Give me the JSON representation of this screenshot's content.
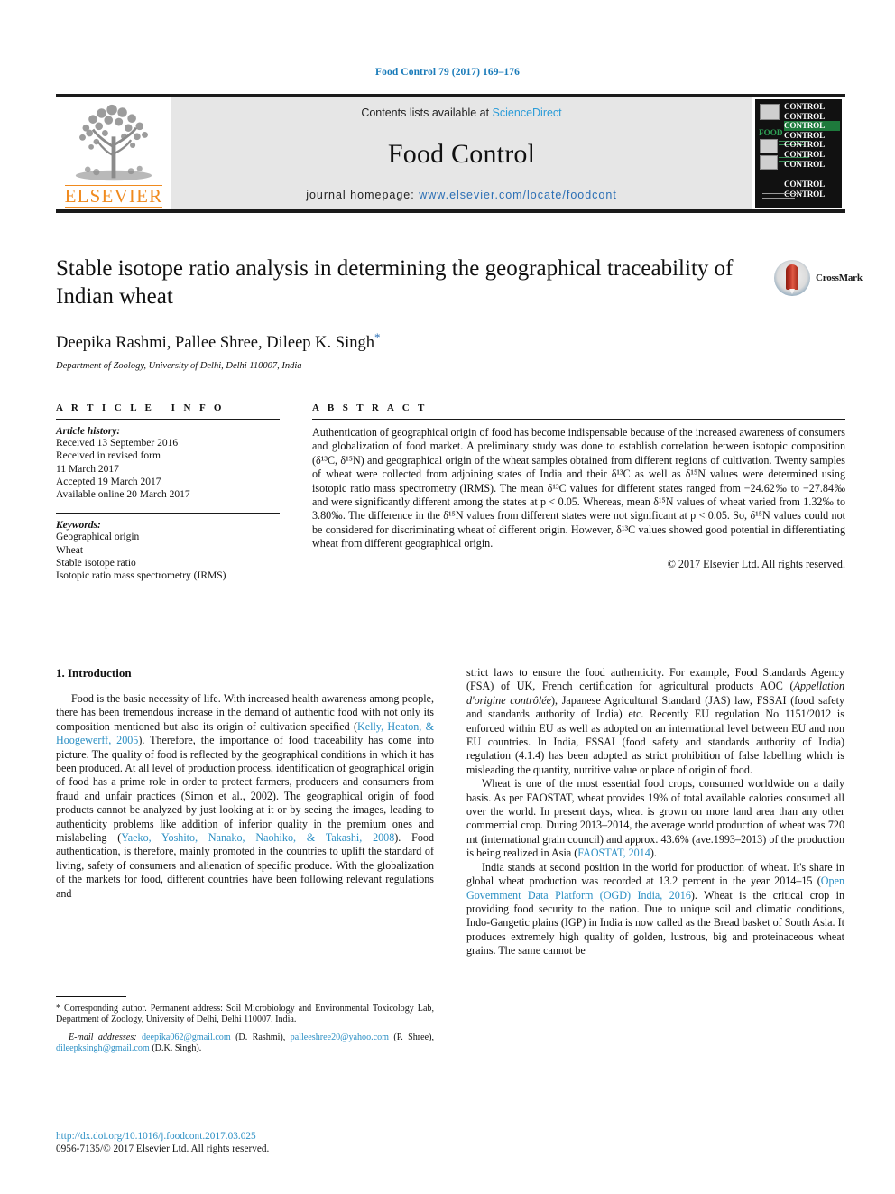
{
  "running_head": "Food Control 79 (2017) 169–176",
  "masthead": {
    "contents_prefix": "Contents lists available at ",
    "sciencedirect": "ScienceDirect",
    "journal_title": "Food Control",
    "homepage_prefix": "journal homepage: ",
    "homepage_url": "www.elsevier.com/locate/foodcont",
    "publisher_wordmark": "ELSEVIER",
    "cover": {
      "food_word": "FOOD",
      "control_word": "CONTROL",
      "control_repeat": 9
    },
    "colors": {
      "link_blue": "#2b9cd8",
      "homepage_blue": "#2b6fb5",
      "elsevier_orange": "#f08a1e",
      "band_grey": "#e6e6e6",
      "cover_green": "#1e7a3c"
    }
  },
  "crossmark": {
    "label": "CrossMark"
  },
  "article": {
    "title": "Stable isotope ratio analysis in determining the geographical traceability of Indian wheat",
    "authors": "Deepika Rashmi, Pallee Shree, Dileep K. Singh",
    "corresponding_marker": "*",
    "affiliation": "Department of Zoology, University of Delhi, Delhi 110007, India"
  },
  "article_info": {
    "heading": "ARTICLE INFO",
    "history_label": "Article history:",
    "history": [
      "Received 13 September 2016",
      "Received in revised form",
      "11 March 2017",
      "Accepted 19 March 2017",
      "Available online 20 March 2017"
    ],
    "keywords_label": "Keywords:",
    "keywords": [
      "Geographical origin",
      "Wheat",
      "Stable isotope ratio",
      "Isotopic ratio mass spectrometry (IRMS)"
    ]
  },
  "abstract": {
    "heading": "ABSTRACT",
    "paragraphs": [
      "Authentication of geographical origin of food has become indispensable because of the increased awareness of consumers and globalization of food market. A preliminary study was done to establish correlation between isotopic composition (δ¹³C, δ¹⁵N) and geographical origin of the wheat samples obtained from different regions of cultivation. Twenty samples of wheat were collected from adjoining states of India and their δ¹³C as well as δ¹⁵N values were determined using isotopic ratio mass spectrometry (IRMS). The mean δ¹³C values for different states ranged from −24.62‰ to −27.84‰ and were significantly different among the states at p < 0.05. Whereas, mean δ¹⁵N values of wheat varied from 1.32‰ to 3.80‰. The difference in the δ¹⁵N values from different states were not significant at p < 0.05. So, δ¹⁵N values could not be considered for discriminating wheat of different origin. However, δ¹³C values showed good potential in differentiating wheat from different geographical origin."
    ],
    "copyright": "© 2017 Elsevier Ltd. All rights reserved."
  },
  "body": {
    "section_title": "1. Introduction",
    "left_paragraphs": [
      "Food is the basic necessity of life. With increased health awareness among people, there has been tremendous increase in the demand of authentic food with not only its composition mentioned but also its origin of cultivation specified (Kelly, Heaton, & Hoogewerff, 2005). Therefore, the importance of food traceability has come into picture. The quality of food is reflected by the geographical conditions in which it has been produced. At all level of production process, identification of geographical origin of food has a prime role in order to protect farmers, producers and consumers from fraud and unfair practices (Simon et al., 2002). The geographical origin of food products cannot be analyzed by just looking at it or by seeing the images, leading to authenticity problems like addition of inferior quality in the premium ones and mislabeling (Yaeko, Yoshito, Nanako, Naohiko, & Takashi, 2008). Food authentication, is therefore, mainly promoted in the countries to uplift the standard of living, safety of consumers and alienation of specific produce. With the globalization of the markets for food, different countries have been following relevant regulations and"
    ],
    "right_paragraphs": [
      "strict laws to ensure the food authenticity. For example, Food Standards Agency (FSA) of UK, French certification for agricultural products AOC (Appellation d'origine contrôlée), Japanese Agricultural Standard (JAS) law, FSSAI (food safety and standards authority of India) etc. Recently EU regulation No 1151/2012 is enforced within EU as well as adopted on an international level between EU and non EU countries. In India, FSSAI (food safety and standards authority of India) regulation (4.1.4) has been adopted as strict prohibition of false labelling which is misleading the quantity, nutritive value or place of origin of food.",
      "Wheat is one of the most essential food crops, consumed worldwide on a daily basis. As per FAOSTAT, wheat provides 19% of total available calories consumed all over the world. In present days, wheat is grown on more land area than any other commercial crop. During 2013–2014, the average world production of wheat was 720 mt (international grain council) and approx. 43.6% (ave.1993–2013) of the production is being realized in Asia (FAOSTAT, 2014).",
      "India stands at second position in the world for production of wheat. It's share in global wheat production was recorded at 13.2 percent in the year 2014–15 (Open Government Data Platform (OGD) India, 2016). Wheat is the critical crop in providing food security to the nation. Due to unique soil and climatic conditions, Indo-Gangetic plains (IGP) in India is now called as the Bread basket of South Asia. It produces extremely high quality of golden, lustrous, big and proteinaceous wheat grains. The same cannot be"
    ],
    "inline_citations": [
      "Kelly, Heaton, & Hoogewerff, 2005",
      "Yaeko, Yoshito, Nanako, Naohiko, & Takashi, 2008",
      "FAOSTAT, 2014",
      "Open Government Data Platform (OGD) India, 2016"
    ]
  },
  "footnotes": {
    "corresponding": "* Corresponding author. Permanent address: Soil Microbiology and Environmental Toxicology Lab, Department of Zoology, University of Delhi, Delhi 110007, India.",
    "email_label": "E-mail addresses:",
    "emails": [
      {
        "address": "deepika062@gmail.com",
        "person": "(D. Rashmi)"
      },
      {
        "address": "palleeshree20@yahoo.com",
        "person": "(P. Shree)"
      },
      {
        "address": "dileepksingh@gmail.com",
        "person": "(D.K. Singh)"
      }
    ],
    "doi": "http://dx.doi.org/10.1016/j.foodcont.2017.03.025",
    "issn_line": "0956-7135/© 2017 Elsevier Ltd. All rights reserved."
  }
}
